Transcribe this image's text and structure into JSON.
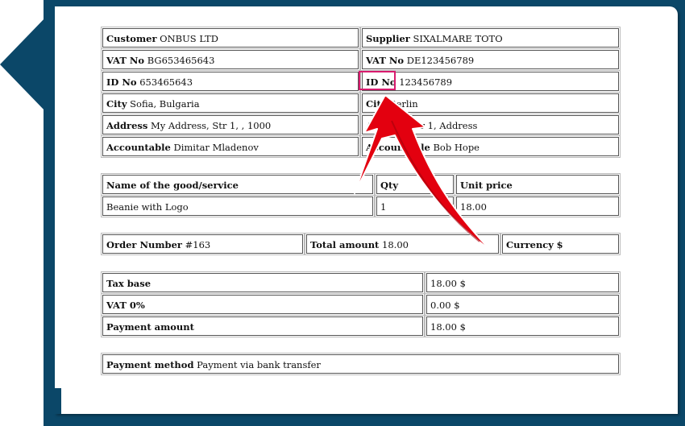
{
  "parties": {
    "customer": {
      "label": "Customer",
      "value": "ONBUS LTD"
    },
    "supplier": {
      "label": "Supplier",
      "value": "SIXALMARE TOTO"
    },
    "customer_vat": {
      "label": "VAT No",
      "value": "BG653465643"
    },
    "supplier_vat": {
      "label": "VAT No",
      "value": "DE123456789"
    },
    "customer_id": {
      "label": "ID No",
      "value": "653465643"
    },
    "supplier_id": {
      "label": "ID No",
      "value": "123456789"
    },
    "customer_city": {
      "label": "City",
      "value": "Sofia, Bulgaria"
    },
    "supplier_city": {
      "label": "City",
      "value": "Berlin"
    },
    "customer_address": {
      "label": "Address",
      "value": "My Address, Str 1, , 1000"
    },
    "supplier_address": {
      "label": "Address",
      "value": "Str 1, Address"
    },
    "customer_accountable": {
      "label": "Accountable",
      "value": "Dimitar Mladenov"
    },
    "supplier_accountable": {
      "label": "Accountable",
      "value": "Bob Hope"
    }
  },
  "goods": {
    "headers": [
      "Name of the good/service",
      "Qty",
      "Unit price"
    ],
    "rows": [
      [
        "Beanie with Logo",
        "1",
        "18.00"
      ]
    ]
  },
  "order": {
    "number_label": "Order Number",
    "number_value": "#163",
    "total_label": "Total amount",
    "total_value": "18.00",
    "currency_label": "Currency",
    "currency_value": "$"
  },
  "totals": [
    {
      "label": "Tax base",
      "value": "18.00 $"
    },
    {
      "label": "VAT 0%",
      "value": "0.00 $"
    },
    {
      "label": "Payment amount",
      "value": "18.00 $"
    }
  ],
  "payment": {
    "label": "Payment method",
    "value": "Payment via bank transfer"
  },
  "colors": {
    "frame": "#0b4768",
    "highlight": "#d81b6e",
    "arrow": "#e3000f"
  }
}
